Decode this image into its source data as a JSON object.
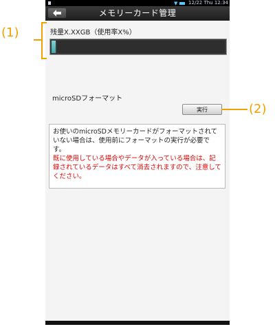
{
  "status_bar": {
    "datetime": "12/22 Thu 12:34",
    "signal_color": "#4ecbff"
  },
  "header": {
    "title": "メモリーカード管理",
    "back_icon": "back-arrow-icon"
  },
  "storage": {
    "remaining_label": "残量X.XXGB（使用率X%）",
    "usage_fraction": 0.02,
    "bar_fill_color": "#3fa8aa",
    "bar_track_color": "#2e2e2e"
  },
  "format": {
    "label": "microSDフォーマット",
    "button_label": "実行"
  },
  "notice": {
    "normal_text": "お使いのmicroSDメモリーカードがフォーマットされていない場合は、使用前にフォーマットの実行が必要です。",
    "warning_text": "既に使用している場合やデータが入っている場合は、記録されているデータはすべて消去されますので、注意してください。",
    "warning_color": "#e00000"
  },
  "annotations": {
    "label_1": "(1)",
    "label_2": "(2)",
    "color": "#f0a000"
  }
}
